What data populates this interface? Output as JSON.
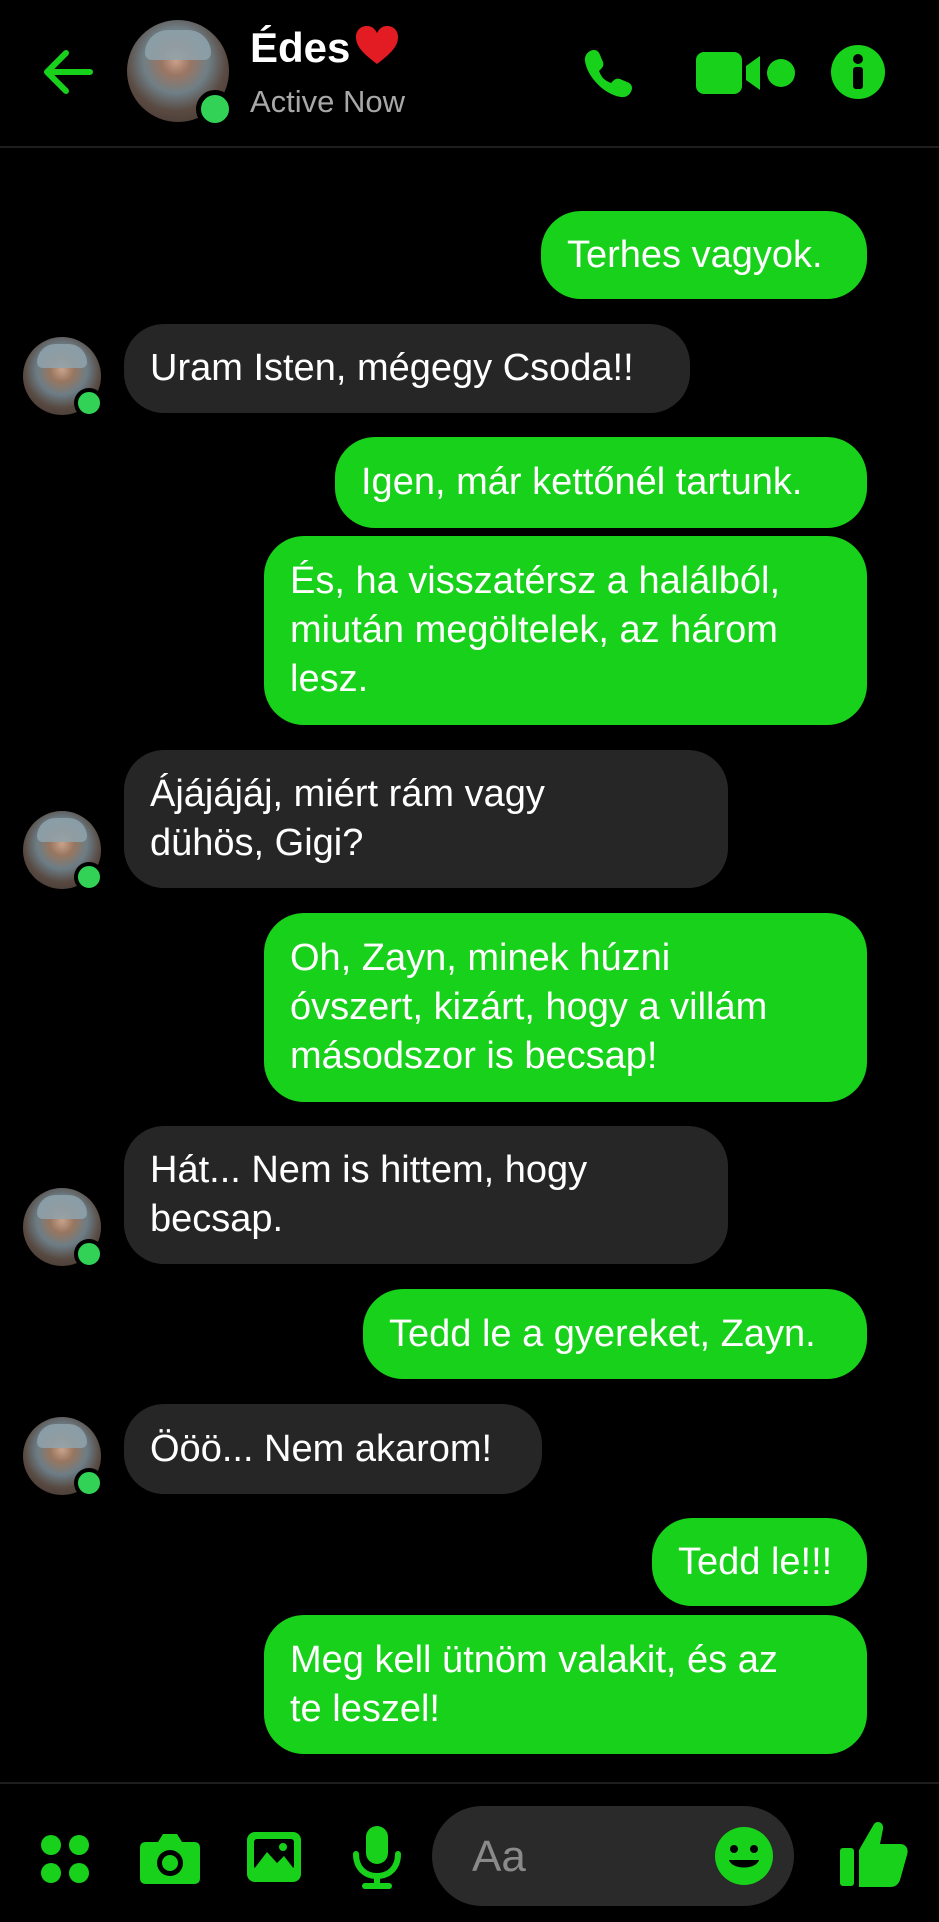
{
  "colors": {
    "accent": "#18d11a",
    "received_bubble": "#262626",
    "background": "#000000",
    "presence": "#31d256"
  },
  "header": {
    "contact_name": "Édes",
    "contact_emoji": "heart",
    "status": "Active Now",
    "icons": [
      "back-arrow-icon",
      "phone-icon",
      "video-camera-icon",
      "info-icon"
    ]
  },
  "messages": [
    {
      "side": "sent",
      "text": "Terhes vagyok."
    },
    {
      "side": "received",
      "text": "Uram Isten, mégegy Csoda!!"
    },
    {
      "side": "sent",
      "text": "Igen, már kettőnél tartunk."
    },
    {
      "side": "sent",
      "text": "És, ha visszatérsz a halálból,\nmiután megöltelek, az három\nlesz."
    },
    {
      "side": "received",
      "text": "Ájájájáj, miért rám vagy\ndühös, Gigi?"
    },
    {
      "side": "sent",
      "text": "Oh, Zayn, minek húzni\nóvszert, kizárt, hogy a villám\nmásodszor is becsap!"
    },
    {
      "side": "received",
      "text": "Hát... Nem is hittem, hogy\nbecsap."
    },
    {
      "side": "sent",
      "text": "Tedd le a gyereket, Zayn."
    },
    {
      "side": "received",
      "text": "Ööö... Nem akarom!"
    },
    {
      "side": "sent",
      "text": "Tedd le!!!"
    },
    {
      "side": "sent",
      "text": "Meg kell ütnöm valakit, és az\nte leszel!"
    }
  ],
  "composer": {
    "placeholder": "Aa",
    "icons": [
      "menu-dots-icon",
      "camera-icon",
      "image-icon",
      "microphone-icon",
      "emoji-icon",
      "thumbs-up-icon"
    ]
  }
}
